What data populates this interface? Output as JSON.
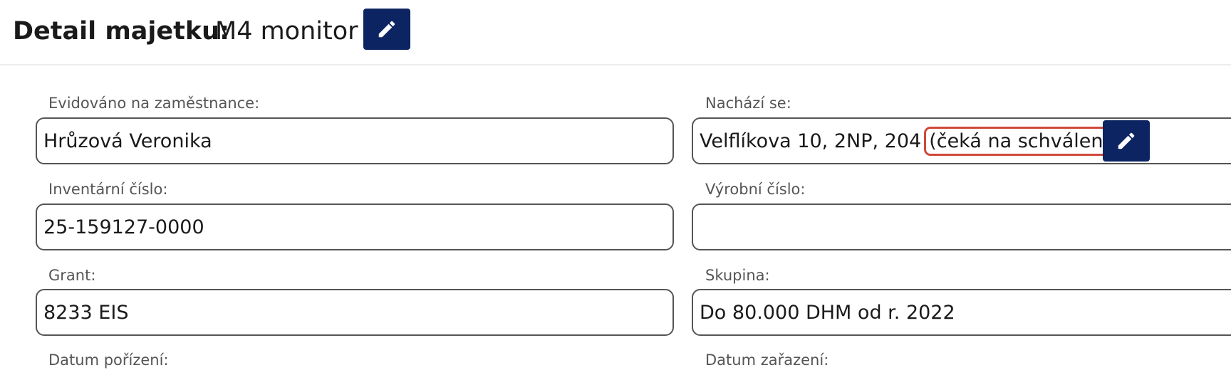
{
  "header": {
    "title_label": "Detail majetku:",
    "title_value": "M4 monitor"
  },
  "fields": {
    "employee": {
      "label": "Evidováno na zaměstnance:",
      "value": "Hrůzová Veronika"
    },
    "location": {
      "label": "Nachází se:",
      "value": "Velflíkova 10, 2NP, 204",
      "status": "(čeká na schválení)"
    },
    "inventory_number": {
      "label": "Inventární číslo:",
      "value": "25-159127-0000"
    },
    "serial_number": {
      "label": "Výrobní číslo:",
      "value": ""
    },
    "grant": {
      "label": "Grant:",
      "value": "8233 EIS"
    },
    "group": {
      "label": "Skupina:",
      "value": "Do 80.000 DHM od r. 2022"
    },
    "purchase_date": {
      "label": "Datum pořízení:"
    },
    "classification_date": {
      "label": "Datum zařazení:"
    }
  },
  "colors": {
    "button_bg": "#0c2461",
    "highlight_border": "#d0483a",
    "field_border": "#555555",
    "label_text": "#555555"
  },
  "icons": {
    "edit": "pencil-icon"
  }
}
